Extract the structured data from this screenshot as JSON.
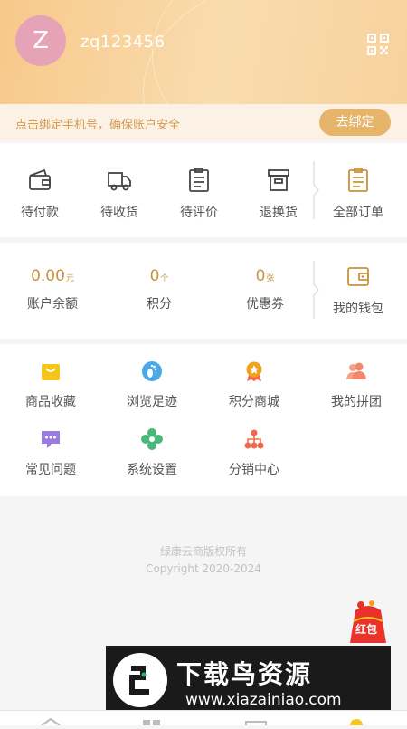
{
  "user": {
    "avatar_letter": "Z",
    "username": "zq123456"
  },
  "bind": {
    "tip": "点击绑定手机号，确保账户安全",
    "button": "去绑定"
  },
  "orders": [
    {
      "label": "待付款",
      "icon": "wallet-icon"
    },
    {
      "label": "待收货",
      "icon": "truck-icon"
    },
    {
      "label": "待评价",
      "icon": "clipboard-icon"
    },
    {
      "label": "退换货",
      "icon": "box-icon"
    }
  ],
  "all_orders": {
    "label": "全部订单",
    "icon": "orders-icon"
  },
  "stats": [
    {
      "value": "0.00",
      "unit": "元",
      "label": "账户余额"
    },
    {
      "value": "0",
      "unit": "个",
      "label": "积分"
    },
    {
      "value": "0",
      "unit": "张",
      "label": "优惠券"
    }
  ],
  "wallet": {
    "label": "我的钱包",
    "icon": "wallet-icon"
  },
  "services": [
    {
      "label": "商品收藏",
      "icon": "shopping-bag-icon",
      "color": "#f5c518"
    },
    {
      "label": "浏览足迹",
      "icon": "footprint-icon",
      "color": "#4aa8e8"
    },
    {
      "label": "积分商城",
      "icon": "medal-icon",
      "color": "#f0a21c"
    },
    {
      "label": "我的拼团",
      "icon": "group-icon",
      "color": "#f4876a"
    },
    {
      "label": "常见问题",
      "icon": "chat-icon",
      "color": "#9b7be0"
    },
    {
      "label": "系统设置",
      "icon": "settings-flower-icon",
      "color": "#49b87a"
    },
    {
      "label": "分销中心",
      "icon": "distribution-icon",
      "color": "#f06a4a"
    }
  ],
  "footer": {
    "line1": "绿康云商版权所有",
    "line2": "Copyright 2020-2024"
  },
  "promo": {
    "text": "红包"
  },
  "watermark": {
    "title": "下载鸟资源",
    "url": "www.xiazainiao.com"
  },
  "colors": {
    "accent": "#c8923f",
    "header": "#f7c98a",
    "button": "#e6b46a"
  }
}
